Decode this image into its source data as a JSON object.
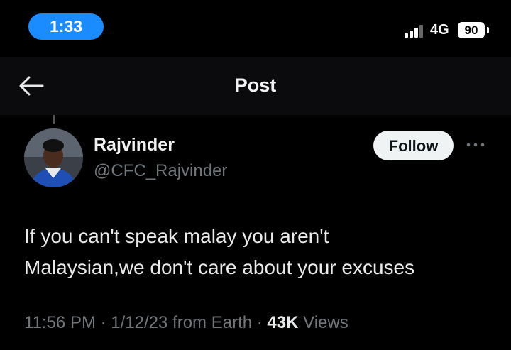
{
  "status_bar": {
    "time": "1:33",
    "network": "4G",
    "battery": "90",
    "time_pill_color": "#1a8cff"
  },
  "nav": {
    "title": "Post",
    "back_icon": "back-arrow-icon"
  },
  "post": {
    "author_name": "Rajvinder",
    "author_handle": "@CFC_Rajvinder",
    "follow_label": "Follow",
    "more_icon": "more-horizontal-icon",
    "text": "If you can't speak malay you aren't\nMalaysian,we don't care about your excuses",
    "time": "11:56 PM",
    "date": "1/12/23",
    "location": "from Earth",
    "separator": "·",
    "views_count": "43K",
    "views_label": "Views"
  }
}
